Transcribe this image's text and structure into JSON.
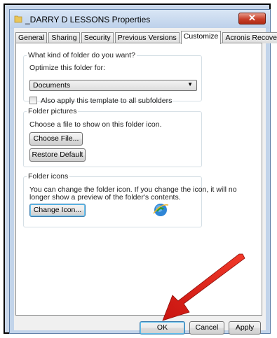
{
  "window": {
    "title": "_DARRY D LESSONS Properties",
    "close_glyph": "✕"
  },
  "tabs": [
    {
      "label": "General",
      "active": false
    },
    {
      "label": "Sharing",
      "active": false
    },
    {
      "label": "Security",
      "active": false
    },
    {
      "label": "Previous Versions",
      "active": false
    },
    {
      "label": "Customize",
      "active": true
    },
    {
      "label": "Acronis Recovery",
      "active": false
    }
  ],
  "kind_group": {
    "title": "What kind of folder do you want?",
    "optimize_label": "Optimize this folder for:",
    "optimize_value": "Documents",
    "also_apply_label": "Also apply this template to all subfolders",
    "also_apply_checked": false
  },
  "pictures_group": {
    "title": "Folder pictures",
    "description": "Choose a file to show on this folder icon.",
    "choose_file_label": "Choose File...",
    "restore_default_label": "Restore Default"
  },
  "icons_group": {
    "title": "Folder icons",
    "description_line1": "You can change the folder icon. If you change the icon, it will no",
    "description_line2": "longer show a preview of the folder's contents.",
    "change_icon_label": "Change Icon...",
    "preview_icon": "internet-explorer-globe-icon"
  },
  "footer": {
    "ok_label": "OK",
    "cancel_label": "Cancel",
    "apply_label": "Apply"
  },
  "annotation": {
    "arrow_color": "#e8221a",
    "points_to": "ok-button"
  },
  "colors": {
    "title_bar": "#c2d4ea",
    "close_button": "#c8402a",
    "default_button_border": "#3c7fb1"
  }
}
